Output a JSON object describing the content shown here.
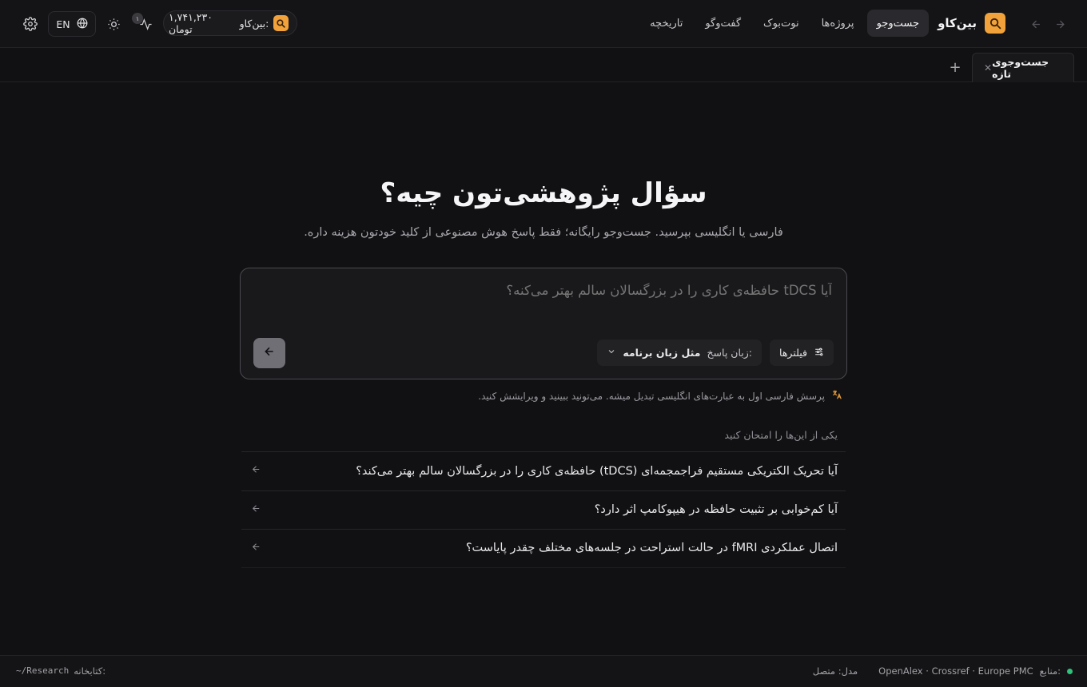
{
  "header": {
    "brand": "بین‌کاو",
    "nav": [
      {
        "label": "جست‌وجو",
        "active": true
      },
      {
        "label": "پروژه‌ها",
        "active": false
      },
      {
        "label": "نوت‌بوک",
        "active": false
      },
      {
        "label": "گفت‌وگو",
        "active": false
      },
      {
        "label": "تاریخچه",
        "active": false
      }
    ],
    "balance_prefix": "بین‌کاو:",
    "balance_value": "۱,۷۴۱,۲۳۰ تومان",
    "activity_count": "۱",
    "lang_label": "EN",
    "icons": [
      "settings-icon",
      "globe-icon",
      "sun-icon",
      "activity-icon",
      "back-arrow-icon",
      "forward-arrow-icon"
    ]
  },
  "tabs": {
    "items": [
      {
        "label": "جست‌وجوی تازه"
      }
    ],
    "add_label": "+"
  },
  "hero": {
    "title": "سؤال پژوهشی‌تون چیه؟",
    "subtitle": "فارسی یا انگلیسی بپرسید. جست‌وجو رایگانه؛ فقط پاسخ هوش مصنوعی از کلید خودتون هزینه داره."
  },
  "search": {
    "placeholder": "آیا tDCS حافظه‌ی کاری را در بزرگسالان سالم بهتر می‌کنه؟",
    "filters_label": "فیلترها",
    "answer_lang_label": "زبان پاسخ:",
    "answer_lang_value": "مثل زبان برنامه"
  },
  "hint": {
    "text": "پرسش فارسی اول به عبارت‌های انگلیسی تبدیل میشه. می‌تونید ببینید و ویرایشش کنید."
  },
  "suggestions": {
    "title": "یکی از این‌ها را امتحان کنید",
    "items": [
      {
        "text": "آیا تحریک الکتریکی مستقیم فراجمجمه‌ای (tDCS) حافظه‌ی کاری را در بزرگسالان سالم بهتر می‌کند؟"
      },
      {
        "text": "آیا کم‌خوابی بر تثبیت حافظه در هیپوکامپ اثر دارد؟"
      },
      {
        "text": "اتصال عملکردی fMRI در حالت استراحت در جلسه‌های مختلف چقدر پایاست؟"
      }
    ]
  },
  "footer": {
    "sources_label": "منابع:",
    "sources_value": "OpenAlex · Crossref · Europe PMC",
    "model_label": "مدل: متصل",
    "library_label": "کتابخانه:",
    "library_path": "~/Research",
    "status_color": "#2fc27a"
  },
  "colors": {
    "accent": "#f2a23a",
    "background": "#111113",
    "status_ok": "#2fc27a"
  }
}
